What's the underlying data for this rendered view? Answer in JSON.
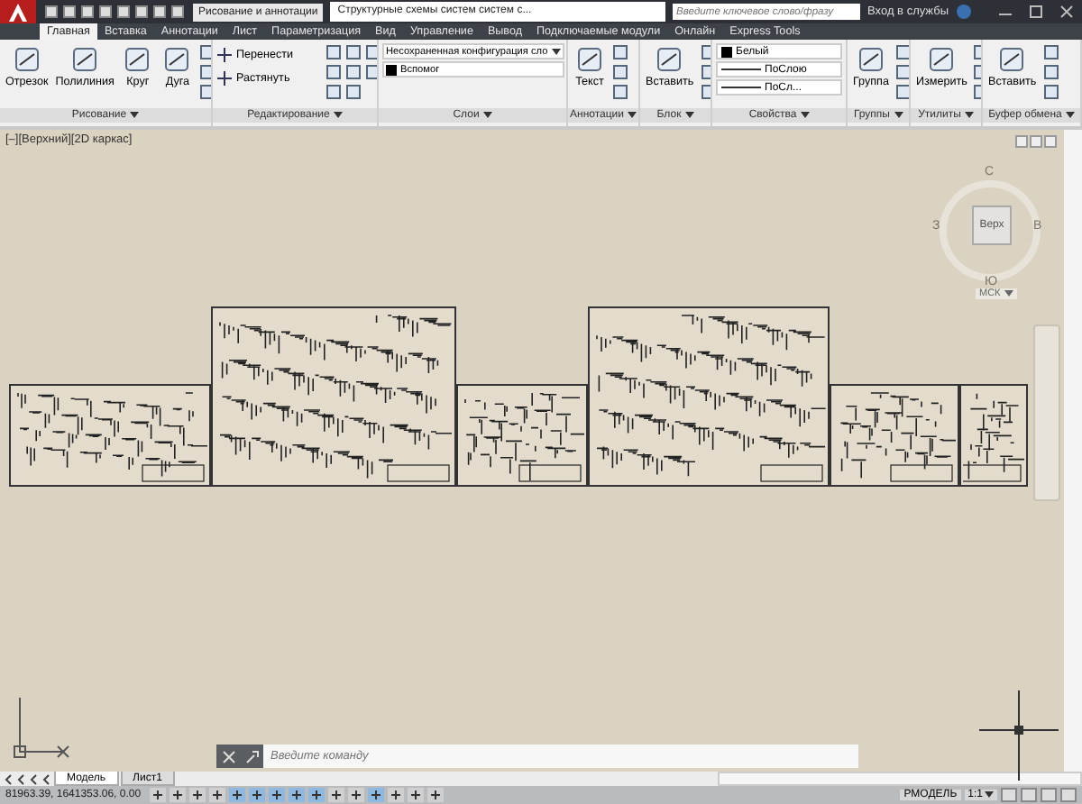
{
  "title_bar": {
    "workspace": "Рисование и аннотации",
    "title": "Структурные схемы систем систем с...",
    "search_placeholder": "Введите ключевое слово/фразу",
    "sign_in": "Вход в службы"
  },
  "tabs": [
    {
      "label": "Главная",
      "selected": true
    },
    {
      "label": "Вставка",
      "selected": false
    },
    {
      "label": "Аннотации",
      "selected": false
    },
    {
      "label": "Лист",
      "selected": false
    },
    {
      "label": "Параметризация",
      "selected": false
    },
    {
      "label": "Вид",
      "selected": false
    },
    {
      "label": "Управление",
      "selected": false
    },
    {
      "label": "Вывод",
      "selected": false
    },
    {
      "label": "Подключаемые модули",
      "selected": false
    },
    {
      "label": "Онлайн",
      "selected": false
    },
    {
      "label": "Express Tools",
      "selected": false
    }
  ],
  "panels": [
    {
      "title": "Рисование",
      "items": [
        {
          "kind": "large",
          "label": "Отрезок"
        },
        {
          "kind": "large",
          "label": "Полилиния"
        },
        {
          "kind": "large",
          "label": "Круг"
        },
        {
          "kind": "large",
          "label": "Дуга"
        }
      ]
    },
    {
      "title": "Редактирование",
      "items": [
        {
          "kind": "small",
          "label": "Перенести"
        },
        {
          "kind": "small",
          "label": "Растянуть"
        }
      ]
    },
    {
      "title": "Слои",
      "items": [
        {
          "kind": "dropdown",
          "value": "Несохраненная конфигурация сло"
        },
        {
          "kind": "layer",
          "value": "Вспомог"
        }
      ]
    },
    {
      "title": "Аннотации",
      "items": [
        {
          "kind": "large",
          "label": "Текст"
        }
      ]
    },
    {
      "title": "Блок",
      "items": [
        {
          "kind": "large",
          "label": "Вставить"
        }
      ]
    },
    {
      "title": "Свойства",
      "items": [
        {
          "kind": "color",
          "value": "Белый"
        },
        {
          "kind": "linetype",
          "value": "ПоСлою"
        },
        {
          "kind": "linetype",
          "value": "ПоСл..."
        }
      ]
    },
    {
      "title": "Группы",
      "items": [
        {
          "kind": "large",
          "label": "Группа"
        }
      ]
    },
    {
      "title": "Утилиты",
      "items": [
        {
          "kind": "large",
          "label": "Измерить"
        }
      ]
    },
    {
      "title": "Буфер обмена",
      "items": [
        {
          "kind": "large",
          "label": "Вставить"
        }
      ]
    }
  ],
  "viewport": {
    "view_label": "[–][Верхний][2D каркас]",
    "compass": {
      "north": "С",
      "west": "З",
      "east": "В",
      "south": "Ю",
      "face": "Верх",
      "ucs": "МСК"
    },
    "command_placeholder": "Введите команду"
  },
  "layout_tabs": [
    {
      "label": "Модель",
      "selected": true
    },
    {
      "label": "Лист1",
      "selected": false
    }
  ],
  "status_bar": {
    "coordinates": "81963.39, 1641353.06, 0.00",
    "toggles": [
      {
        "on": false
      },
      {
        "on": false
      },
      {
        "on": false
      },
      {
        "on": false
      },
      {
        "on": true
      },
      {
        "on": true
      },
      {
        "on": true
      },
      {
        "on": true
      },
      {
        "on": true
      },
      {
        "on": false
      },
      {
        "on": false
      },
      {
        "on": true
      },
      {
        "on": false
      },
      {
        "on": false
      },
      {
        "on": false
      }
    ],
    "space": "РМОДЕЛЬ",
    "scale": "1:1"
  }
}
